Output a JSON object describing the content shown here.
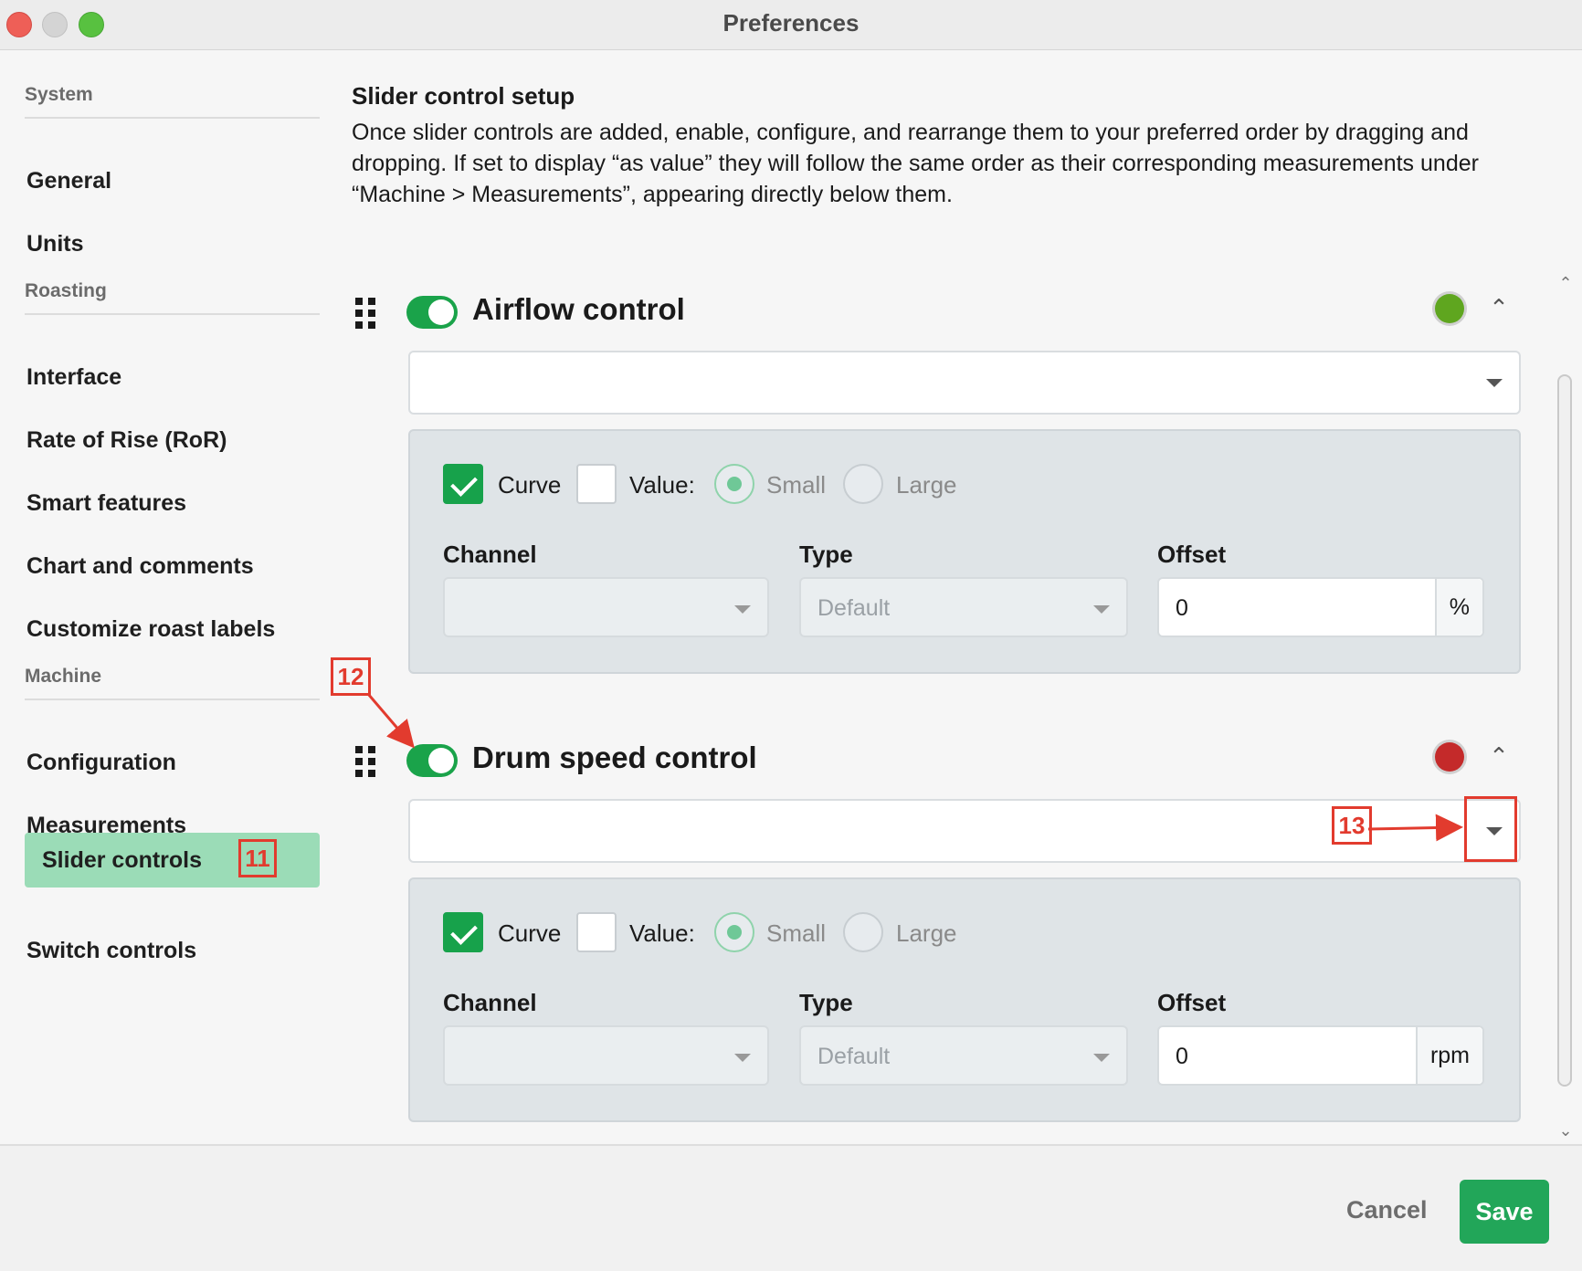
{
  "window": {
    "title": "Preferences"
  },
  "sidebar": {
    "sections": [
      {
        "heading": "System",
        "items": [
          "General",
          "Units"
        ]
      },
      {
        "heading": "Roasting",
        "items": [
          "Interface",
          "Rate of Rise (RoR)",
          "Smart features",
          "Chart and comments",
          "Customize roast labels"
        ]
      },
      {
        "heading": "Machine",
        "items": [
          "Configuration",
          "Measurements",
          "Slider controls",
          "Switch controls"
        ]
      }
    ],
    "active_item": "Slider controls"
  },
  "main": {
    "title": "Slider control setup",
    "description": "Once slider controls are added, enable, configure, and rearrange them to your preferred order by dragging and dropping. If set to display “as value” they will follow the same order as their corresponding measurements under “Machine > Measurements”, appearing directly below them."
  },
  "controls": [
    {
      "name": "Airflow control",
      "enabled": true,
      "status_color": "#5fa61f",
      "select_value": "",
      "curve_checked": true,
      "value_checked": false,
      "curve_label": "Curve",
      "value_label": "Value:",
      "size_small": "Small",
      "size_large": "Large",
      "channel_label": "Channel",
      "channel_value": "",
      "type_label": "Type",
      "type_value": "Default",
      "offset_label": "Offset",
      "offset_value": "0",
      "offset_unit": "%"
    },
    {
      "name": "Drum speed control",
      "enabled": true,
      "status_color": "#c42a2a",
      "select_value": "",
      "curve_checked": true,
      "value_checked": false,
      "curve_label": "Curve",
      "value_label": "Value:",
      "size_small": "Small",
      "size_large": "Large",
      "channel_label": "Channel",
      "channel_value": "",
      "type_label": "Type",
      "type_value": "Default",
      "offset_label": "Offset",
      "offset_value": "0",
      "offset_unit": "rpm"
    }
  ],
  "footer": {
    "cancel_label": "Cancel",
    "save_label": "Save"
  },
  "annotations": {
    "a11": "11",
    "a12": "12",
    "a13": "13",
    "color": "#e23b2e"
  },
  "colors": {
    "accent": "#1aa34a",
    "active_nav": "#9bdcb7"
  }
}
